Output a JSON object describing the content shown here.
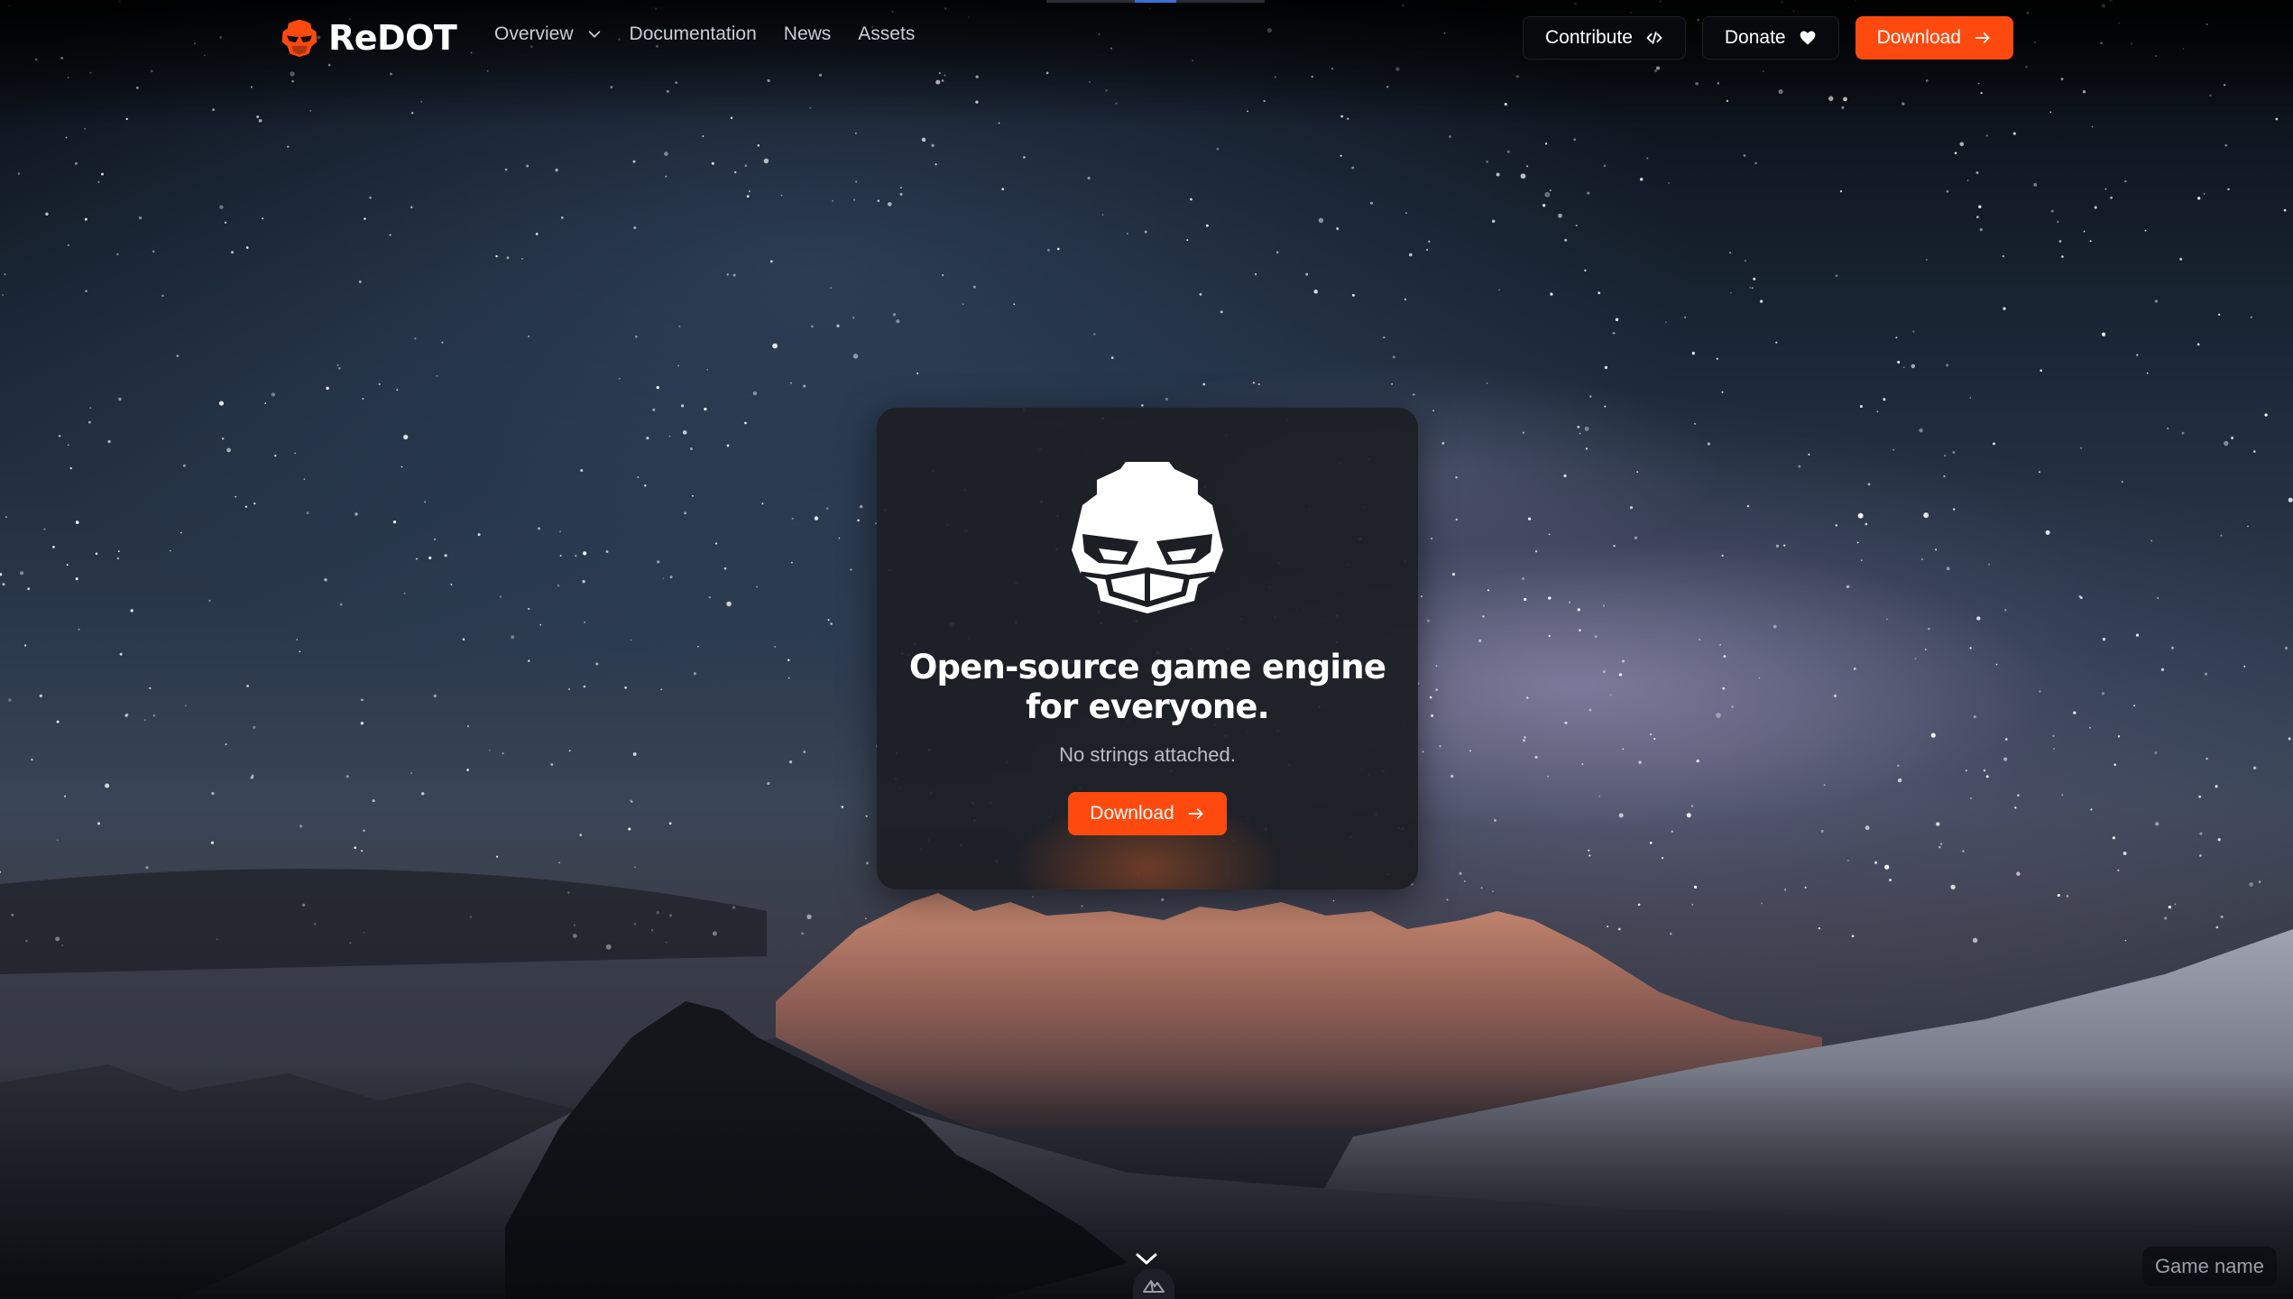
{
  "brand": {
    "name": "ReDOT",
    "logo_icon": "redot-robot-icon"
  },
  "nav": {
    "links": [
      {
        "label": "Overview",
        "has_dropdown": true
      },
      {
        "label": "Documentation"
      },
      {
        "label": "News"
      },
      {
        "label": "Assets"
      }
    ]
  },
  "actions": {
    "contribute_label": "Contribute",
    "contribute_icon": "code-icon",
    "donate_label": "Donate",
    "donate_icon": "heart-icon",
    "download_label": "Download",
    "download_icon": "arrow-right-icon"
  },
  "hero": {
    "title_line1": "Open-source game engine",
    "title_line2": "for everyone.",
    "subtitle": "No strings attached.",
    "download_label": "Download",
    "logo_icon": "redot-robot-icon"
  },
  "footer": {
    "game_name": "Game name",
    "scroll_icon": "chevron-down-icon",
    "badge_icon": "mountain-icon"
  },
  "colors": {
    "accent": "#ff4a0f",
    "card_bg": "#1c1e24",
    "dark_button": "#08090c"
  }
}
